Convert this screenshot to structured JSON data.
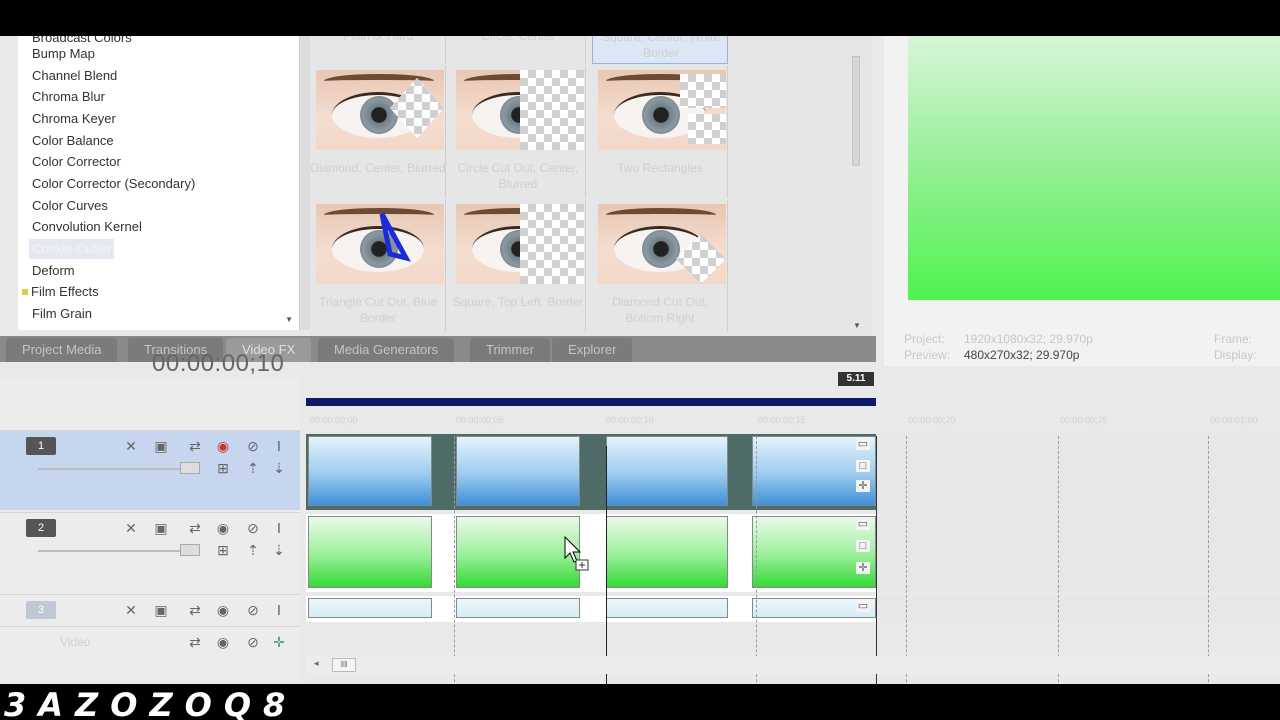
{
  "fx_list": {
    "items": [
      {
        "label": "Broadcast Colors",
        "dot": false
      },
      {
        "label": "Bump Map",
        "dot": false
      },
      {
        "label": "Channel Blend",
        "dot": false
      },
      {
        "label": "Chroma Blur",
        "dot": false
      },
      {
        "label": "Chroma Keyer",
        "dot": false
      },
      {
        "label": "Color Balance",
        "dot": false
      },
      {
        "label": "Color Corrector",
        "dot": false
      },
      {
        "label": "Color Corrector (Secondary)",
        "dot": false
      },
      {
        "label": "Color Curves",
        "dot": false
      },
      {
        "label": "Convolution Kernel",
        "dot": false
      },
      {
        "label": "Cookie Cutter",
        "dot": false,
        "selected": true
      },
      {
        "label": "Deform",
        "dot": false
      },
      {
        "label": "Film Effects",
        "dot": true
      },
      {
        "label": "Film Grain",
        "dot": false
      }
    ]
  },
  "presets": {
    "top_row": [
      "Plain or Hard",
      "Circle, Center",
      "Square, Center, White Border"
    ],
    "row1": [
      "Diamond, Center, Blurred",
      "Circle Cut Out, Center, Blurred",
      "Two Rectangles"
    ],
    "row2": [
      "Triangle Cut Out, Blue Border",
      "Square, Top Left, Border",
      "Diamond Cut Out, Bottom Right"
    ]
  },
  "tabs": [
    "Project Media",
    "Transitions",
    "Video FX",
    "Media Generators",
    "Trimmer",
    "Explorer"
  ],
  "active_tab": "Video FX",
  "preview": {
    "project_label": "Project:",
    "project_value": "1920x1080x32; 29.970p",
    "preview_label": "Preview:",
    "preview_value": "480x270x32; 29.970p",
    "frame_label": "Frame:",
    "display_label": "Display:",
    "badge": "5.11"
  },
  "timeline": {
    "timecode": "00:00:00;10",
    "ruler_labels": [
      "00:00:00;00",
      "00:00:00;05",
      "00:00:00;10",
      "00:00:00;15",
      "00:00:00;20",
      "00:00:00;25",
      "00:00:01;00"
    ],
    "tracks": [
      {
        "number": "1",
        "name": ""
      },
      {
        "number": "2",
        "name": ""
      },
      {
        "number": "3",
        "name": ""
      }
    ],
    "bus_label": "Video"
  },
  "watermark": "3AZOZOQ8",
  "colors": {
    "track1_clip": "#6fb1e6",
    "track2_clip": "#5fe65f",
    "selected_track_bg": "#c5d6ee",
    "preview_green": "#4ff34f"
  }
}
